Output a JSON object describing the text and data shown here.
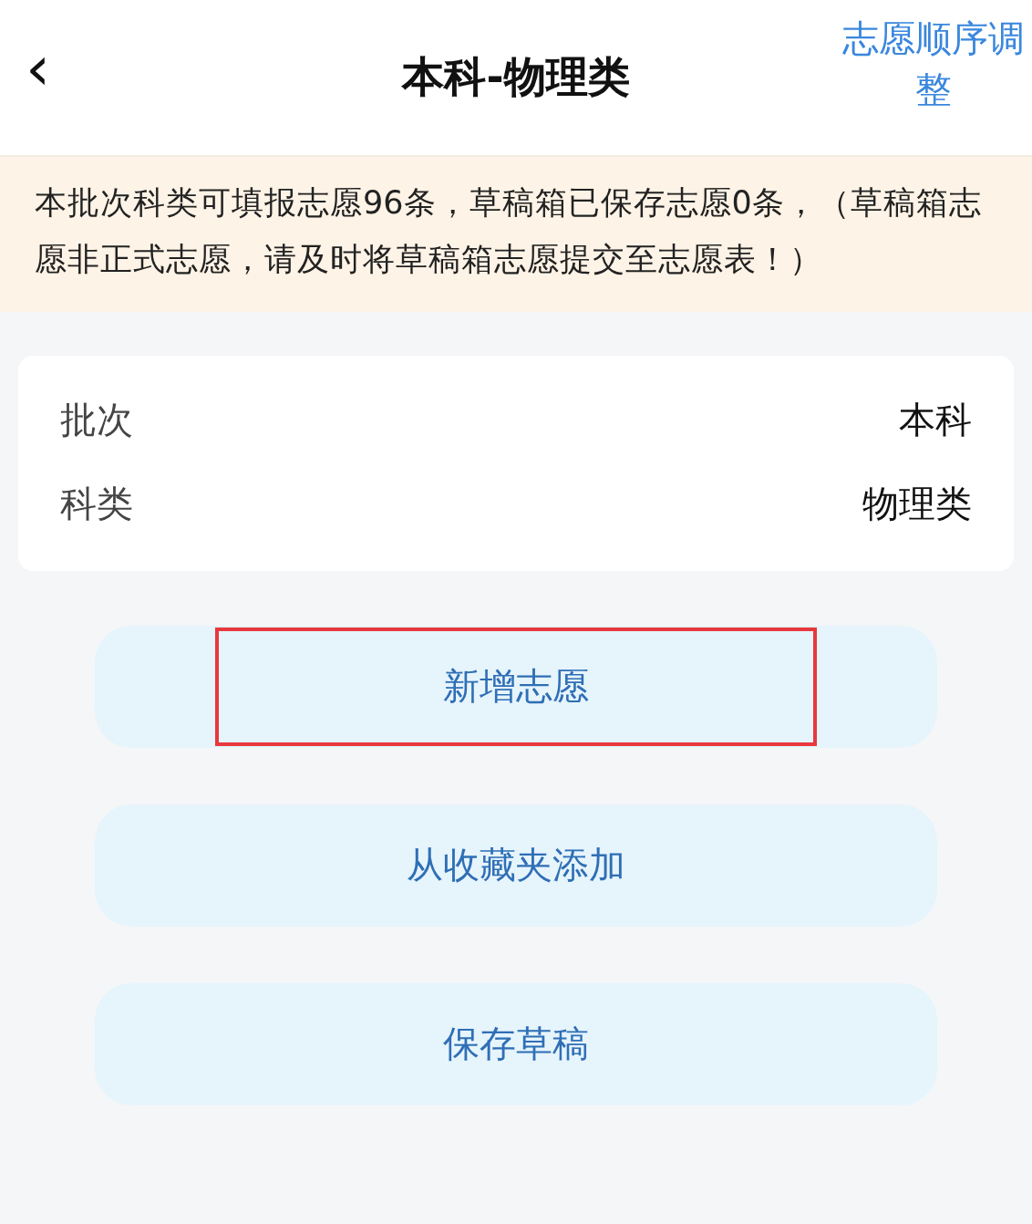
{
  "header": {
    "back": "‹",
    "title": "本科-物理类",
    "action": "志愿顺序调整"
  },
  "notice": "本批次科类可填报志愿96条，草稿箱已保存志愿0条，（草稿箱志愿非正式志愿，请及时将草稿箱志愿提交至志愿表！）",
  "info_rows": [
    {
      "label": "批次",
      "value": "本科"
    },
    {
      "label": "科类",
      "value": "物理类"
    }
  ],
  "buttons": [
    {
      "label": "新增志愿",
      "highlighted": true
    },
    {
      "label": "从收藏夹添加",
      "highlighted": false
    },
    {
      "label": "保存草稿",
      "highlighted": false
    }
  ]
}
